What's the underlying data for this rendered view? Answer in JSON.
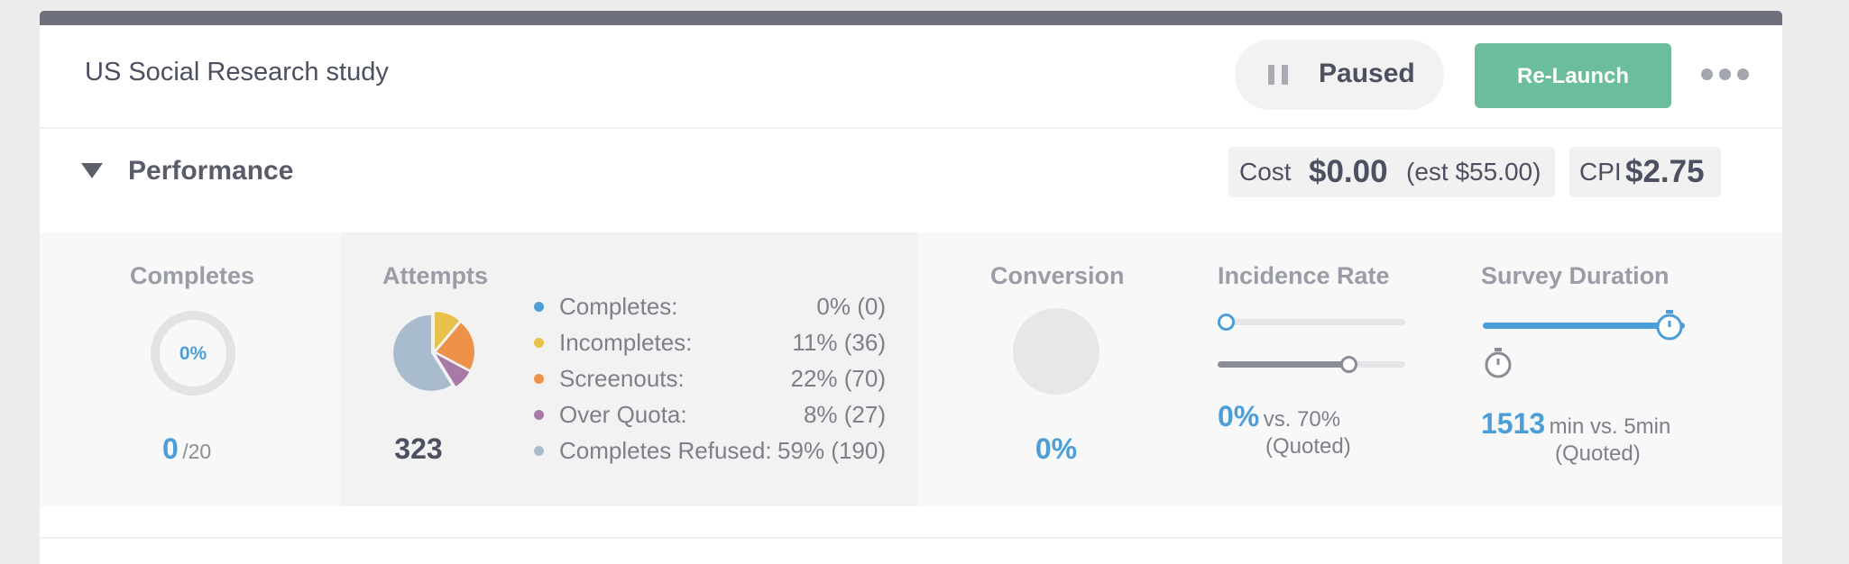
{
  "study": {
    "title": "US Social Research study",
    "status_label": "Paused",
    "relaunch_label": "Re-Launch"
  },
  "performance": {
    "title": "Performance",
    "cost_label": "Cost",
    "cost_value": "$0.00",
    "cost_estimate": "(est $55.00)",
    "cpi_label": "CPI",
    "cpi_value": "$2.75"
  },
  "completes": {
    "title": "Completes",
    "percent": "0%",
    "count": "0",
    "target": "/20",
    "progress_fraction": 0
  },
  "attempts": {
    "title": "Attempts",
    "total": "323",
    "breakdown": [
      {
        "label": "Completes:",
        "value": "0% (0)",
        "count": 0,
        "color": "#4b9ed8"
      },
      {
        "label": "Incompletes:",
        "value": "11% (36)",
        "count": 36,
        "color": "#e8c14a"
      },
      {
        "label": "Screenouts:",
        "value": "22% (70)",
        "count": 70,
        "color": "#ee9249"
      },
      {
        "label": "Over Quota:",
        "value": "8% (27)",
        "count": 27,
        "color": "#a77aa6"
      },
      {
        "label": "Completes Refused:",
        "value": "59% (190)",
        "count": 190,
        "color": "#a9bccf"
      }
    ]
  },
  "conversion": {
    "title": "Conversion",
    "value": "0%"
  },
  "incidence_rate": {
    "title": "Incidence Rate",
    "actual": "0%",
    "quoted_text": "vs. 70%",
    "quoted_label": "(Quoted)",
    "actual_fraction": 0,
    "quoted_fraction": 0.7
  },
  "survey_duration": {
    "title": "Survey Duration",
    "actual": "1513",
    "quoted_text": "min vs. 5min",
    "quoted_label": "(Quoted)",
    "actual_fraction": 1.0,
    "quoted_fraction": 0.0
  },
  "colors": {
    "accent_blue": "#4b9ed8",
    "relaunch_green": "#6cbd9c",
    "header_bar": "#6e717d"
  }
}
